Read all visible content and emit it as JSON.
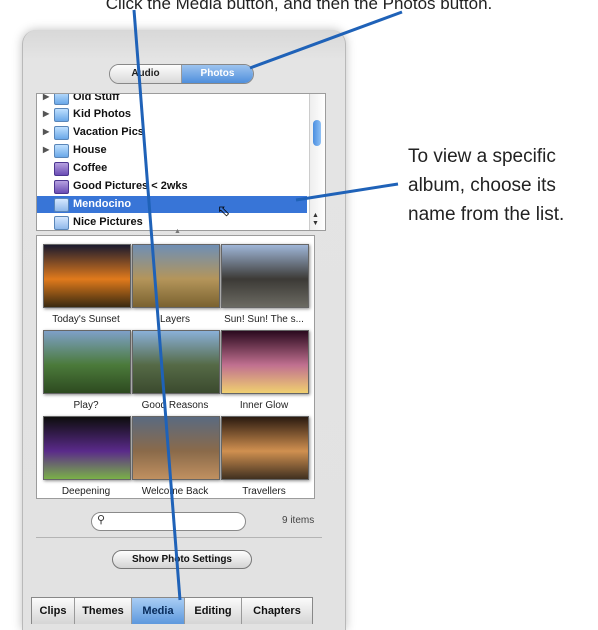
{
  "captions": {
    "top": "Click the Media button, and then the Photos button.",
    "callout": "To view a specific album, choose its name from the list."
  },
  "segmented": {
    "audio_label": "Audio",
    "photos_label": "Photos",
    "selected": "Photos"
  },
  "albums": [
    {
      "label": "Old Stuff",
      "expandable": true,
      "icon": "folder-icon"
    },
    {
      "label": "Kid Photos",
      "expandable": true,
      "icon": "folder-icon"
    },
    {
      "label": "Vacation Pics",
      "expandable": true,
      "icon": "folder-icon"
    },
    {
      "label": "House",
      "expandable": true,
      "icon": "folder-icon"
    },
    {
      "label": "Coffee",
      "expandable": false,
      "icon": "smart-album-icon"
    },
    {
      "label": "Good Pictures < 2wks",
      "expandable": false,
      "icon": "smart-album-icon"
    },
    {
      "label": "Mendocino",
      "expandable": false,
      "icon": "album-icon",
      "selected": true
    },
    {
      "label": "Nice Pictures",
      "expandable": false,
      "icon": "album-icon"
    }
  ],
  "photos": [
    {
      "caption": "Today's Sunset",
      "colors": [
        "#1a1a2e",
        "#e07a1c",
        "#3a2a10"
      ]
    },
    {
      "caption": "Layers",
      "colors": [
        "#6f8fb5",
        "#b4955a",
        "#7a6230"
      ]
    },
    {
      "caption": "Sun! Sun! The s...",
      "colors": [
        "#9fb6d8",
        "#3c3a36",
        "#6b6a62"
      ]
    },
    {
      "caption": "Play?",
      "colors": [
        "#7ea0c8",
        "#4b7a3a",
        "#2d4a20"
      ]
    },
    {
      "caption": "Good Reasons",
      "colors": [
        "#8ab0d8",
        "#556a46",
        "#3b4a2e"
      ]
    },
    {
      "caption": "Inner Glow",
      "colors": [
        "#2a0a1e",
        "#c07090",
        "#f0d070"
      ]
    },
    {
      "caption": "Deepening",
      "colors": [
        "#0d0d0d",
        "#5a2a8a",
        "#7ab048"
      ]
    },
    {
      "caption": "Welcome Back",
      "colors": [
        "#5a6a80",
        "#8a6a4a",
        "#c09060"
      ]
    },
    {
      "caption": "Travellers",
      "colors": [
        "#2a1a10",
        "#d09050",
        "#403020"
      ]
    }
  ],
  "search": {
    "placeholder": "",
    "icon": "magnifier-icon"
  },
  "item_count": "9 items",
  "show_photo_settings_label": "Show Photo Settings",
  "tabs": [
    {
      "label": "Clips"
    },
    {
      "label": "Themes"
    },
    {
      "label": "Media",
      "active": true
    },
    {
      "label": "Editing"
    },
    {
      "label": "Chapters"
    }
  ],
  "colors": {
    "selection": "#3875d7",
    "accent_line": "#1f62b8"
  }
}
